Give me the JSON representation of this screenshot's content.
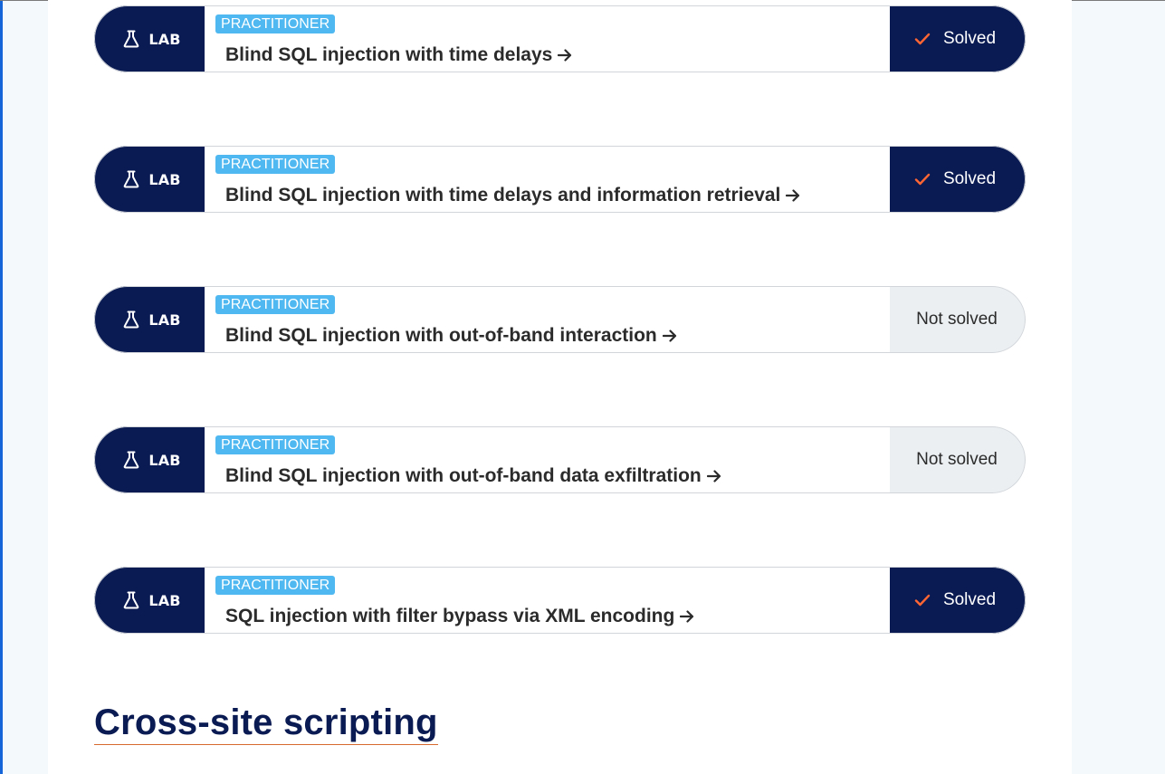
{
  "labs": [
    {
      "type_label": "LAB",
      "level": "PRACTITIONER",
      "title": "Blind SQL injection with time delays",
      "status": "solved",
      "status_label": "Solved"
    },
    {
      "type_label": "LAB",
      "level": "PRACTITIONER",
      "title": "Blind SQL injection with time delays and information retrieval",
      "status": "solved",
      "status_label": "Solved"
    },
    {
      "type_label": "LAB",
      "level": "PRACTITIONER",
      "title": "Blind SQL injection with out-of-band interaction",
      "status": "not-solved",
      "status_label": "Not solved"
    },
    {
      "type_label": "LAB",
      "level": "PRACTITIONER",
      "title": "Blind SQL injection with out-of-band data exfiltration",
      "status": "not-solved",
      "status_label": "Not solved"
    },
    {
      "type_label": "LAB",
      "level": "PRACTITIONER",
      "title": "SQL injection with filter bypass via XML encoding",
      "status": "solved",
      "status_label": "Solved"
    }
  ],
  "section": {
    "heading": "Cross-site scripting"
  },
  "icons": {
    "lab": "flask-icon",
    "link": "arrow-right-icon",
    "solved": "check-icon"
  },
  "colors": {
    "navy": "#0a1a52",
    "badge_blue": "#4fb8f0",
    "check_orange": "#ff6633",
    "not_solved_bg": "#ebeff2",
    "heading_underline": "#d8692e"
  }
}
